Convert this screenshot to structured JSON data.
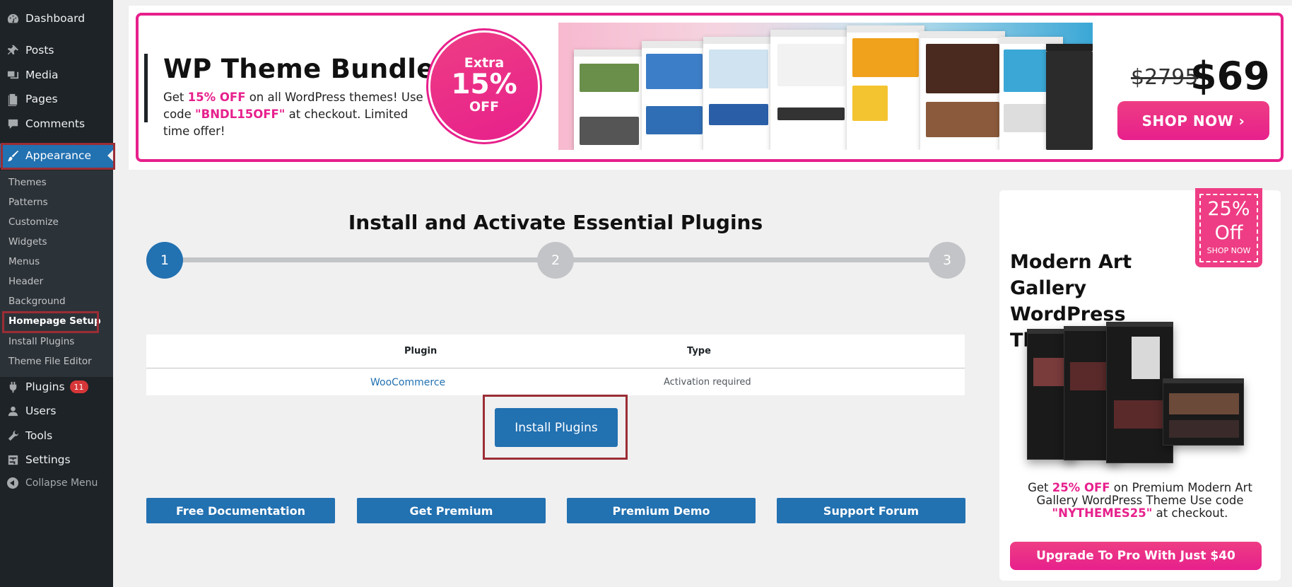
{
  "sidebar": {
    "items": [
      {
        "label": "Dashboard",
        "icon": "dashboard-icon"
      },
      {
        "label": "Posts",
        "icon": "pin-icon"
      },
      {
        "label": "Media",
        "icon": "media-icon"
      },
      {
        "label": "Pages",
        "icon": "pages-icon"
      },
      {
        "label": "Comments",
        "icon": "comments-icon"
      },
      {
        "label": "Appearance",
        "icon": "brush-icon"
      },
      {
        "label": "Plugins",
        "icon": "plugin-icon",
        "badge": "11"
      },
      {
        "label": "Users",
        "icon": "user-icon"
      },
      {
        "label": "Tools",
        "icon": "wrench-icon"
      },
      {
        "label": "Settings",
        "icon": "settings-icon"
      }
    ],
    "submenu": [
      "Themes",
      "Patterns",
      "Customize",
      "Widgets",
      "Menus",
      "Header",
      "Background",
      "Homepage Setup",
      "Install Plugins",
      "Theme File Editor"
    ],
    "collapse_label": "Collapse Menu",
    "active_color": "#2271b1"
  },
  "banner": {
    "title": "WP Theme Bundle",
    "desc_pre": "Get ",
    "desc_highlight": "15% OFF",
    "desc_mid": " on all WordPress themes! Use code ",
    "desc_code": "\"BNDL15OFF\"",
    "desc_post": " at checkout. Limited time offer!",
    "circle_line1": "Extra",
    "circle_line2": "15%",
    "circle_line3": "OFF",
    "old_price": "$2795",
    "new_price": "$69",
    "shop_label": "SHOP NOW ›",
    "accent_color": "#e7208c"
  },
  "wizard": {
    "title": "Install and Activate Essential Plugins",
    "steps": [
      "1",
      "2",
      "3"
    ],
    "table": {
      "headers": [
        "Plugin",
        "Type"
      ],
      "rows": [
        {
          "plugin": "WooCommerce",
          "type": "Activation required"
        }
      ]
    },
    "install_label": "Install Plugins",
    "links": [
      "Free Documentation",
      "Get Premium",
      "Premium Demo",
      "Support Forum"
    ]
  },
  "promo": {
    "ribbon_pct": "25%",
    "ribbon_off": "Off",
    "ribbon_shop": "SHOP NOW",
    "title": "Modern Art Gallery WordPress Theme",
    "text_pre": "Get ",
    "text_highlight": "25% OFF",
    "text_mid": " on Premium Modern Art Gallery WordPress Theme Use code ",
    "text_code": "\"NYTHEMES25\"",
    "text_post": " at checkout.",
    "upgrade_label": "Upgrade To Pro With Just $40"
  }
}
